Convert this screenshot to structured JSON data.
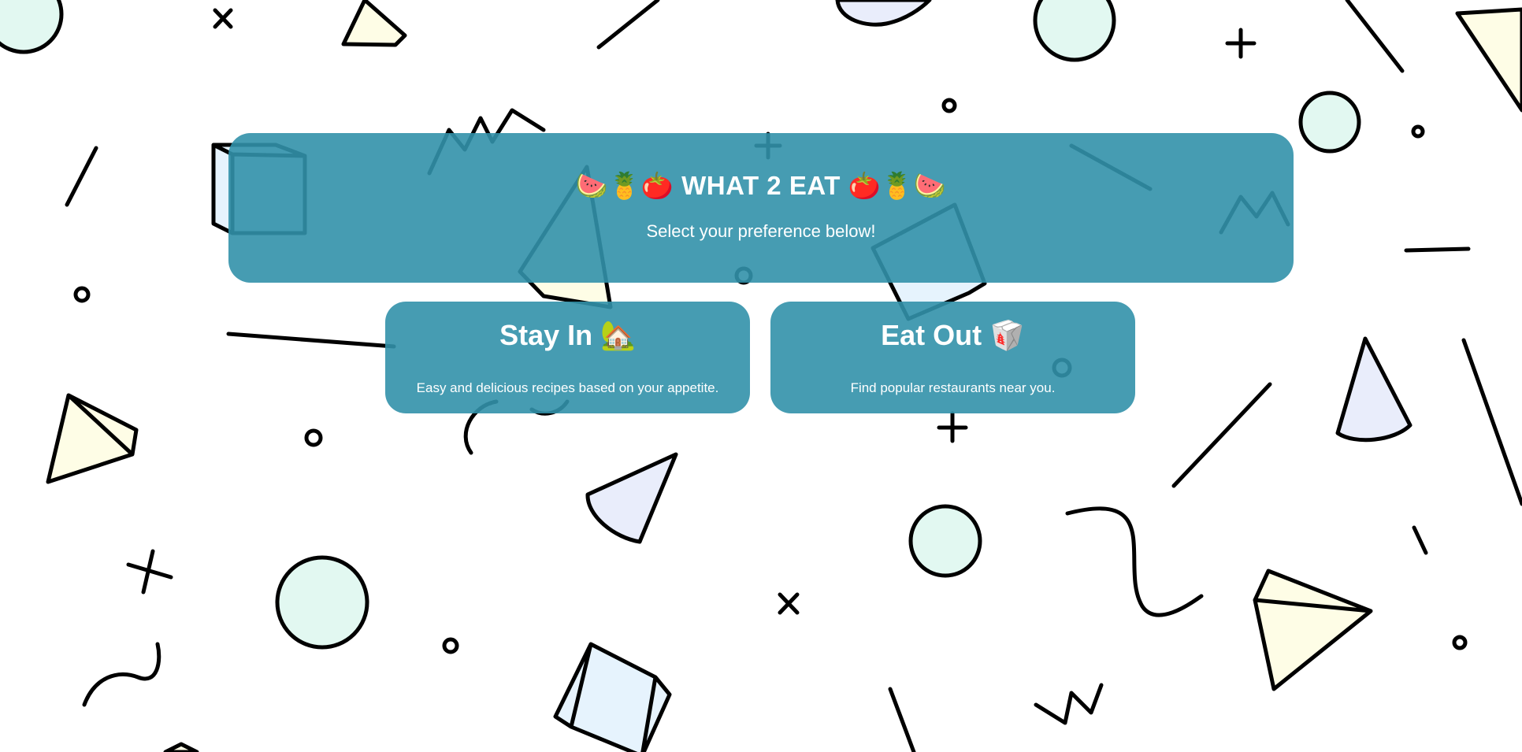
{
  "header": {
    "title": "🍉🍍🍅 WHAT 2 EAT 🍅🍍🍉",
    "subtitle": "Select your preference below!"
  },
  "options": [
    {
      "title": "Stay In 🏡",
      "description": "Easy and delicious recipes based on your appetite."
    },
    {
      "title": "Eat Out 🥡",
      "description": "Find popular restaurants near you."
    }
  ],
  "colors": {
    "card": "#3291aa",
    "text": "#ffffff",
    "shape_mint": "#e2f8f1",
    "shape_yellow": "#fefde6",
    "shape_lavender": "#e9edfb",
    "shape_blue": "#e6f3fd"
  }
}
